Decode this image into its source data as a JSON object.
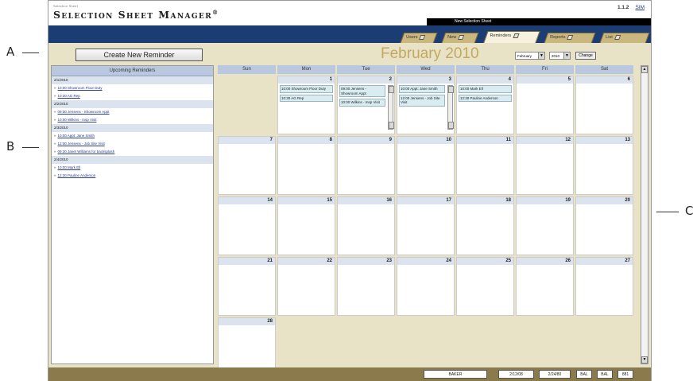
{
  "callouts": {
    "a": "A",
    "b": "B",
    "c": "C"
  },
  "app": {
    "logo_tiny": "Selection Sheet",
    "logo_main": "Selection Sheet Manager",
    "logo_mark": "®",
    "version": "1.1.2",
    "version_link": "SIM",
    "sheet_name": "New Selection Sheet"
  },
  "tabs": [
    {
      "label": "Users",
      "active": false
    },
    {
      "label": "New",
      "active": false
    },
    {
      "label": "Reminders",
      "active": true
    },
    {
      "label": "Reports",
      "active": false
    },
    {
      "label": "List",
      "active": false
    }
  ],
  "left_panel": {
    "create_button": "Create New Reminder",
    "header": "Upcoming Reminders",
    "groups": [
      {
        "date": "2/1/2010",
        "items": [
          "10:00 Showroom Floor Duty",
          "10:30 AG Rep"
        ]
      },
      {
        "date": "2/2/2010",
        "items": [
          "09:00 Jensens - Showroom Appt",
          "10:00 Wilkins - Insp Visit"
        ]
      },
      {
        "date": "2/3/2010",
        "items": [
          "10:00 Appt: Jane Smith",
          "12:00 Jensens - Job Site Visit",
          "09:30 Janet Williams for backsplash"
        ]
      },
      {
        "date": "2/4/2010",
        "items": [
          "10:00 Mark Ell",
          "12:30 Pauline Anderson"
        ]
      }
    ]
  },
  "calendar": {
    "month_title": "February 2010",
    "month_select": "February",
    "year_select": "2010",
    "change_button": "Change",
    "daynames": [
      "Sun",
      "Mon",
      "Tue",
      "Wed",
      "Thu",
      "Fri",
      "Sat"
    ],
    "weeks": [
      [
        "",
        "1",
        "2",
        "3",
        "4",
        "5",
        "6"
      ],
      [
        "7",
        "8",
        "9",
        "10",
        "11",
        "12",
        "13"
      ],
      [
        "14",
        "15",
        "16",
        "17",
        "18",
        "19",
        "20"
      ],
      [
        "21",
        "22",
        "23",
        "24",
        "25",
        "26",
        "27"
      ],
      [
        "28",
        "",
        "",
        "",
        "",
        "",
        ""
      ]
    ],
    "events": {
      "1": [
        "10:00 Showroom Floor Duty",
        "10:30 AG Rep"
      ],
      "2": [
        "09:00 Jensens - Showroom Appt",
        "10:00 Wilkins - Insp Visit"
      ],
      "3": [
        "10:00 Appt: Jane Smith",
        "12:00 Jensens - Job Site Visit"
      ],
      "4": [
        "10:00 Mark Ell",
        "12:30 Pauline Anderson"
      ]
    }
  },
  "status_bar": [
    "BAKER",
    "2/12/08",
    "2/24/80",
    "BAL",
    "BAL",
    "881"
  ]
}
